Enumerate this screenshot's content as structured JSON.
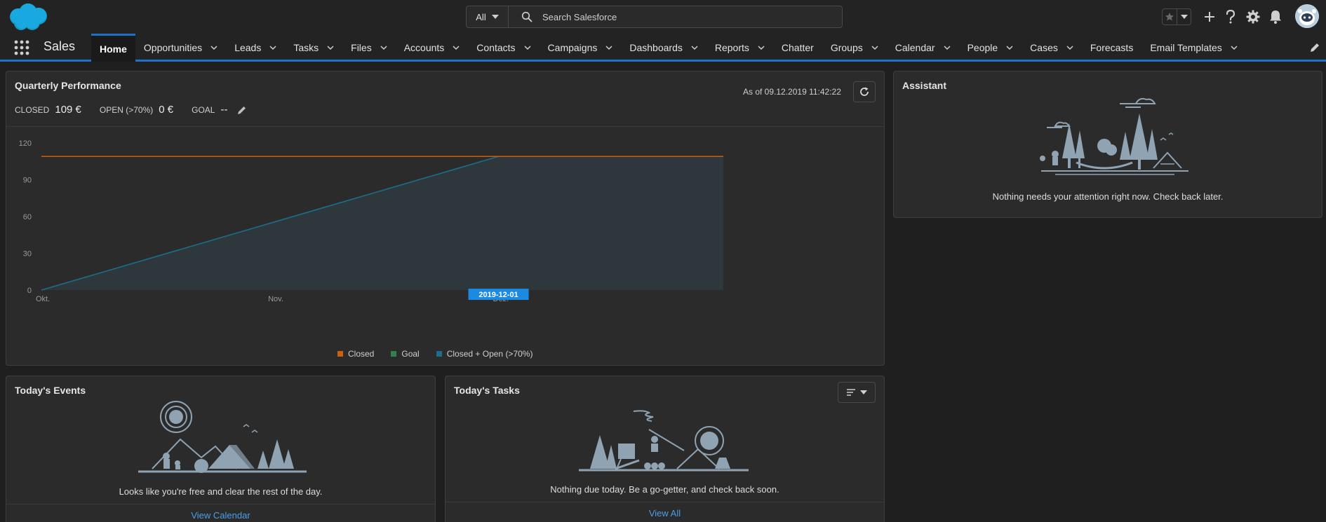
{
  "header": {
    "search_scope": "All",
    "search_placeholder": "Search Salesforce",
    "icons": [
      "salesforce-logo",
      "search-icon",
      "star-icon",
      "chevron-down-icon",
      "plus-icon",
      "help-icon",
      "gear-icon",
      "bell-icon",
      "avatar"
    ]
  },
  "nav": {
    "app_name": "Sales",
    "items": [
      {
        "label": "Home",
        "active": true,
        "dropdown": false
      },
      {
        "label": "Opportunities",
        "dropdown": true
      },
      {
        "label": "Leads",
        "dropdown": true
      },
      {
        "label": "Tasks",
        "dropdown": true
      },
      {
        "label": "Files",
        "dropdown": true
      },
      {
        "label": "Accounts",
        "dropdown": true
      },
      {
        "label": "Contacts",
        "dropdown": true
      },
      {
        "label": "Campaigns",
        "dropdown": true
      },
      {
        "label": "Dashboards",
        "dropdown": true
      },
      {
        "label": "Reports",
        "dropdown": true
      },
      {
        "label": "Chatter",
        "dropdown": false
      },
      {
        "label": "Groups",
        "dropdown": true
      },
      {
        "label": "Calendar",
        "dropdown": true
      },
      {
        "label": "People",
        "dropdown": true
      },
      {
        "label": "Cases",
        "dropdown": true
      },
      {
        "label": "Forecasts",
        "dropdown": false
      },
      {
        "label": "Email Templates",
        "dropdown": true
      }
    ]
  },
  "performance": {
    "title": "Quarterly Performance",
    "closed_label": "CLOSED",
    "closed_value": "109 €",
    "open_label": "OPEN (>70%)",
    "open_value": "0 €",
    "goal_label": "GOAL",
    "goal_value": "--",
    "as_of": "As of 09.12.2019 11:42:22"
  },
  "chart_data": {
    "type": "line",
    "y_ticks": [
      "120",
      "90",
      "60",
      "30",
      "0"
    ],
    "ylim": [
      0,
      120
    ],
    "x_ticks": [
      "Okt.",
      "Nov.",
      "Dez."
    ],
    "tooltip": "2019-12-01",
    "series": [
      {
        "name": "Closed",
        "color": "#c8600f",
        "x": [
          "2019-10-01",
          "2019-12-01",
          "2019-12-31"
        ],
        "values": [
          109,
          109,
          109
        ]
      },
      {
        "name": "Goal",
        "color": "#2e844a",
        "x": [],
        "values": []
      },
      {
        "name": "Closed + Open (>70%)",
        "color": "#1b6e8c",
        "x": [
          "2019-10-01",
          "2019-12-01",
          "2019-12-31"
        ],
        "values": [
          0,
          109,
          109
        ]
      }
    ],
    "grid": false,
    "legend": "bottom"
  },
  "assistant": {
    "title": "Assistant",
    "message": "Nothing needs your attention right now. Check back later."
  },
  "events": {
    "title": "Today's Events",
    "message": "Looks like you're free and clear the rest of the day.",
    "link": "View Calendar"
  },
  "tasks": {
    "title": "Today's Tasks",
    "message": "Nothing due today. Be a go-getter, and check back soon.",
    "link": "View All"
  },
  "colors": {
    "accent": "#1b72c8",
    "link": "#4a9fe8",
    "card_bg": "#2b2b2b",
    "page_bg": "#1f1f1f"
  }
}
